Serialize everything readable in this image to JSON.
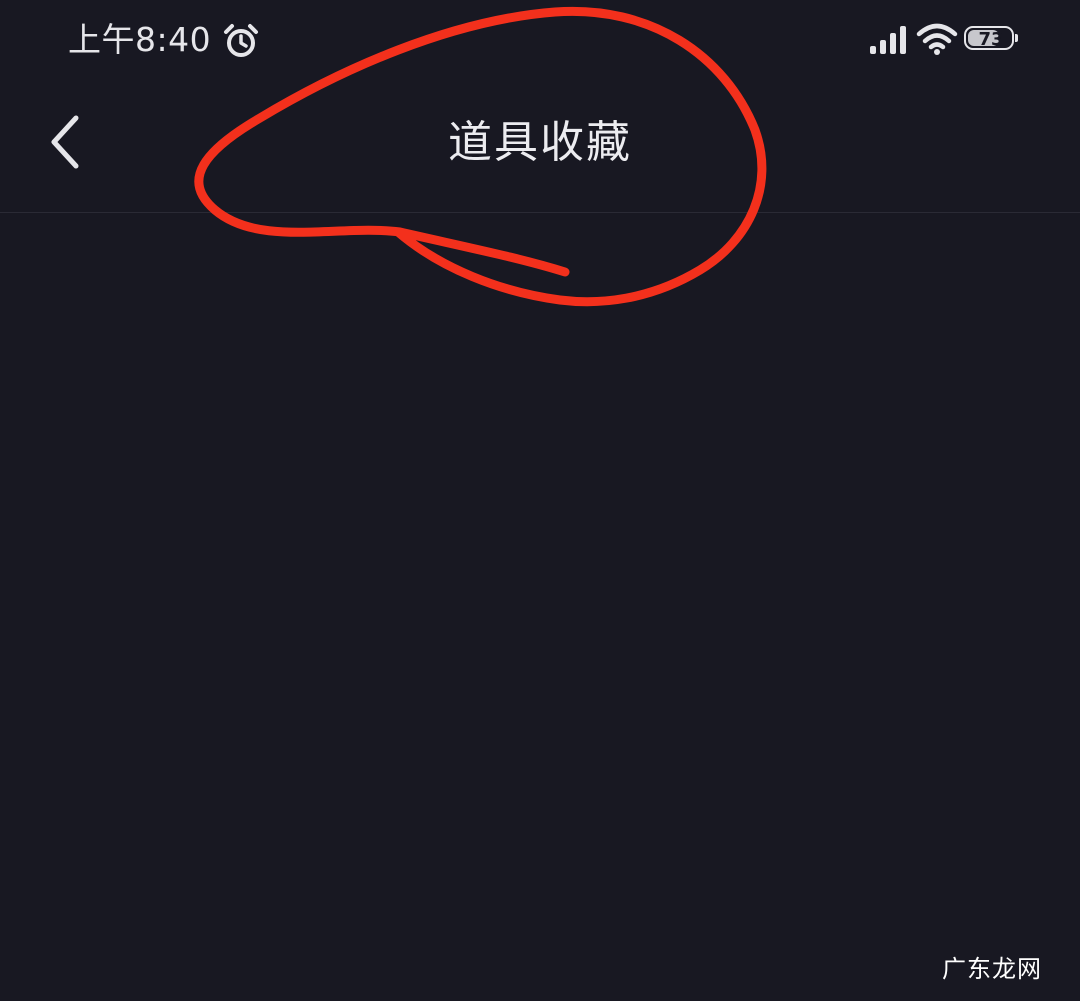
{
  "status_bar": {
    "time": "上午8:40",
    "battery_level": "73",
    "icons": [
      "alarm-icon",
      "signal-icon",
      "wifi-icon",
      "battery-icon"
    ]
  },
  "nav": {
    "back_icon": "chevron-left-icon",
    "title": "道具收藏"
  },
  "watermark": "广东龙网",
  "colors": {
    "background": "#181822",
    "text": "#ececf0",
    "annotation_stroke": "#f3301c"
  }
}
